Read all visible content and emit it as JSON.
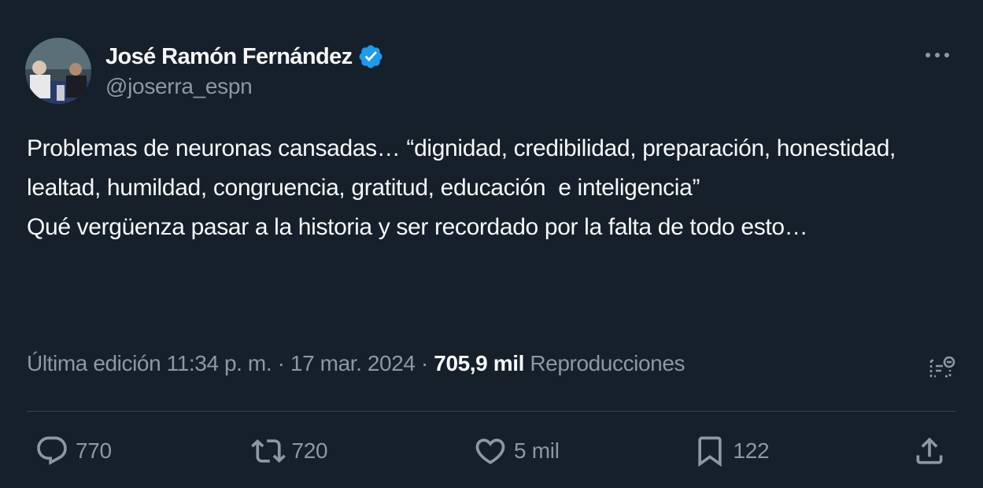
{
  "author": {
    "display_name": "José Ramón Fernández",
    "handle": "@joserra_espn",
    "verified": true,
    "verified_color": "#1d9bf0"
  },
  "tweet": {
    "paragraph_1": "Problemas de neuronas cansadas… “dignidad, credibilidad, preparación, honestidad, lealtad, humildad, congruencia, gratitud, educación  e inteligencia”",
    "paragraph_2": "Qué vergüenza pasar a la historia y ser recordado por la falta de todo esto…"
  },
  "meta": {
    "edited_label": "Última edición 11:34 p. m.",
    "separator": " · ",
    "date": "17 mar. 2024",
    "views_count": "705,9 mil",
    "views_label": "Reproducciones"
  },
  "actions": {
    "replies": "770",
    "reposts": "720",
    "likes": "5 mil",
    "bookmarks": "122"
  },
  "icons": {
    "more": "more-horizontal-icon",
    "analytics": "analytics-icon",
    "reply": "reply-icon",
    "repost": "repost-icon",
    "like": "heart-icon",
    "bookmark": "bookmark-icon",
    "share": "share-icon"
  },
  "colors": {
    "background": "#15202b",
    "text": "#f7f9f9",
    "muted": "#8b98a5",
    "divider": "#38444d"
  }
}
